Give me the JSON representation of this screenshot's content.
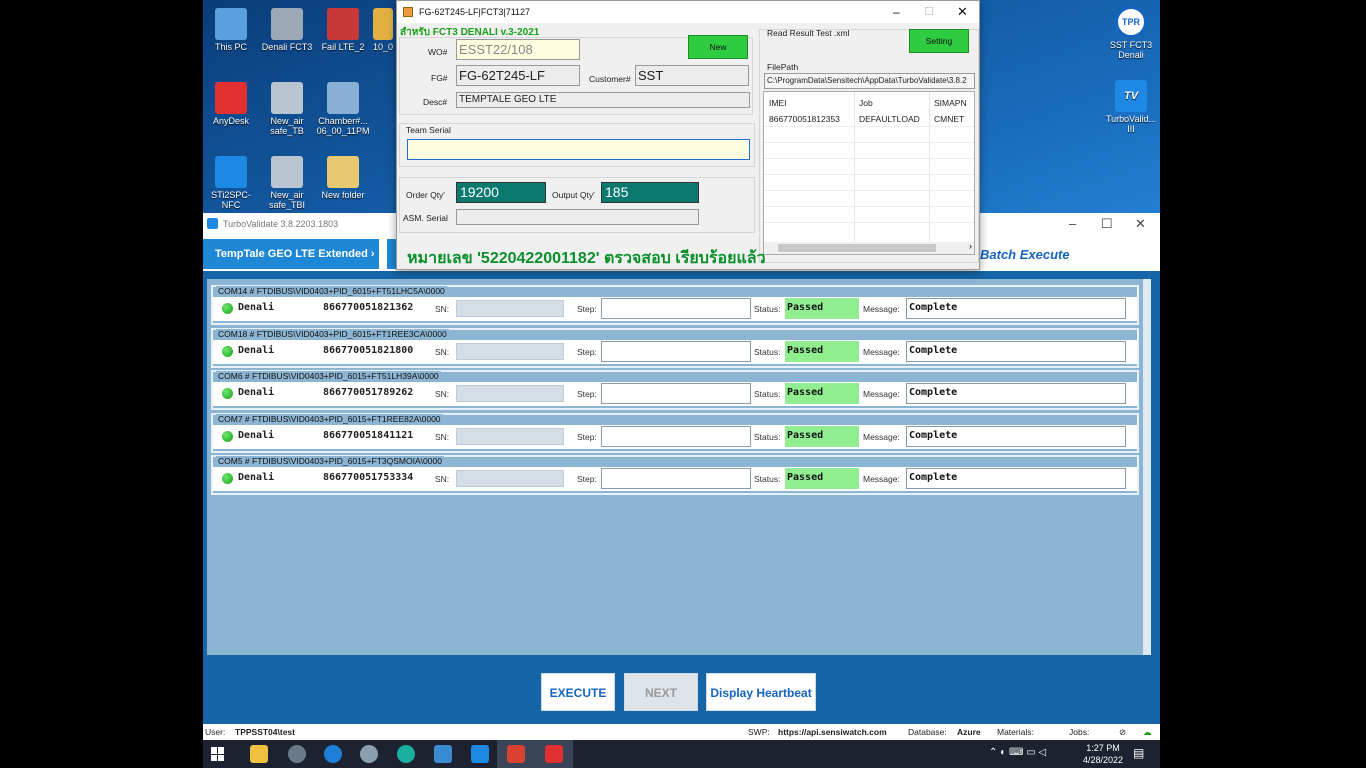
{
  "desktop": {
    "icons_left": [
      {
        "label": "This PC",
        "color": "#5aa0e0"
      },
      {
        "label": "Denali FCT3",
        "color": "#9aa8b8"
      },
      {
        "label": "Fail LTE_2",
        "color": "#c83838"
      },
      {
        "label": "10_0",
        "color": "#e0b040"
      },
      {
        "label": "AnyDesk",
        "color": "#e03030"
      },
      {
        "label": "New_air safe_TB",
        "color": "#b8c4d0"
      },
      {
        "label": "Chamber#... 06_00_11PM",
        "color": "#8ab0d8"
      },
      {
        "label": "STi2SPC-NFC",
        "color": "#1e88e5"
      },
      {
        "label": "New_air safe_TBI",
        "color": "#b8c4d0"
      },
      {
        "label": "New folder",
        "color": "#e8c870"
      }
    ],
    "icons_right": [
      {
        "label": "SST FCT3 Denali",
        "badge": "TPR"
      },
      {
        "label": "TurboValid... III",
        "badge": "TV"
      }
    ]
  },
  "fct_window": {
    "title": "FG-62T245-LF|FCT3|71127",
    "subtitle": "สำหรับ FCT3 DENALI v.3-2021",
    "wo_label": "WO#",
    "wo_value": "ESST22/108",
    "new_button": "New",
    "fg_label": "FG#",
    "fg_value": "FG-62T245-LF",
    "customer_label": "Customer#",
    "customer_value": "SST",
    "desc_label": "Desc#",
    "desc_value": "TEMPTALE GEO LTE",
    "team_serial_label": "Team Serial",
    "team_serial_value": "",
    "order_qty_label": "Order Qty'",
    "order_qty_value": "19200",
    "output_qty_label": "Output Qty'",
    "output_qty_value": "185",
    "asm_serial_label": "ASM. Serial",
    "read_result_label": "Read Result Test .xml",
    "setting_button": "Setting",
    "filepath_label": "FilePath",
    "filepath_value": "C:\\ProgramData\\Sensitech\\AppData\\TurboValidate\\3.8.2",
    "grid_headers": [
      "IMEI",
      "Job",
      "SIMAPN"
    ],
    "grid_rows": [
      [
        "866770051812353",
        "DEFAULTLOAD",
        "CMNET"
      ]
    ],
    "thai_message": "หมายเลข '5220422001182' ตรวจสอบ เรียบร้อยแล้ว"
  },
  "turbo_window": {
    "title": "TurboValidate 3.8.2203.1803",
    "tab_label": "TempTale GEO LTE Extended  ›",
    "batch_execute": "Batch Execute",
    "sn_label": "SN:",
    "step_label": "Step:",
    "status_label": "Status:",
    "message_label": "Message:",
    "ports": [
      {
        "title": "COM14 # FTDIBUS\\VID0403+PID_6015+FT51LHC5A\\0000",
        "device": "Denali",
        "imei": "866770051821362",
        "status": "Passed",
        "message": "Complete",
        "status_color": "#90ee90"
      },
      {
        "title": "COM18 # FTDIBUS\\VID0403+PID_6015+FT1REE3CA\\0000",
        "device": "Denali",
        "imei": "866770051821800",
        "status": "Passed",
        "message": "Complete",
        "status_color": "#90ee90"
      },
      {
        "title": "COM6 # FTDIBUS\\VID0403+PID_6015+FT51LH39A\\0000",
        "device": "Denali",
        "imei": "866770051789262",
        "status": "Passed",
        "message": "Complete",
        "status_color": "#90ee90"
      },
      {
        "title": "COM7 # FTDIBUS\\VID0403+PID_6015+FT1REE82A\\0000",
        "device": "Denali",
        "imei": "866770051841121",
        "status": "Passed",
        "message": "Complete",
        "status_color": "#90ee90"
      },
      {
        "title": "COM5 # FTDIBUS\\VID0403+PID_6015+FT3QSMOIA\\0000",
        "device": "Denali",
        "imei": "866770051753334",
        "status": "Passed",
        "message": "Complete",
        "status_color": "#90ee90"
      }
    ],
    "buttons": {
      "execute": "EXECUTE",
      "next": "NEXT",
      "heartbeat": "Display Heartbeat"
    },
    "status_bar": {
      "user_label": "User:",
      "user_value": "TPPSST04\\test",
      "swp_label": "SWP:",
      "swp_value": "https://api.sensiwatch.com",
      "db_label": "Database:",
      "db_value": "Azure",
      "materials_label": "Materials:",
      "jobs_label": "Jobs:"
    }
  },
  "taskbar": {
    "time": "1:27 PM",
    "date": "4/28/2022",
    "apps": [
      "windows-logo",
      "file-explorer",
      "settings",
      "edge-legacy",
      "paint",
      "edge",
      "calculator",
      "turbo-validate",
      "denali-app",
      "anydesk"
    ]
  }
}
